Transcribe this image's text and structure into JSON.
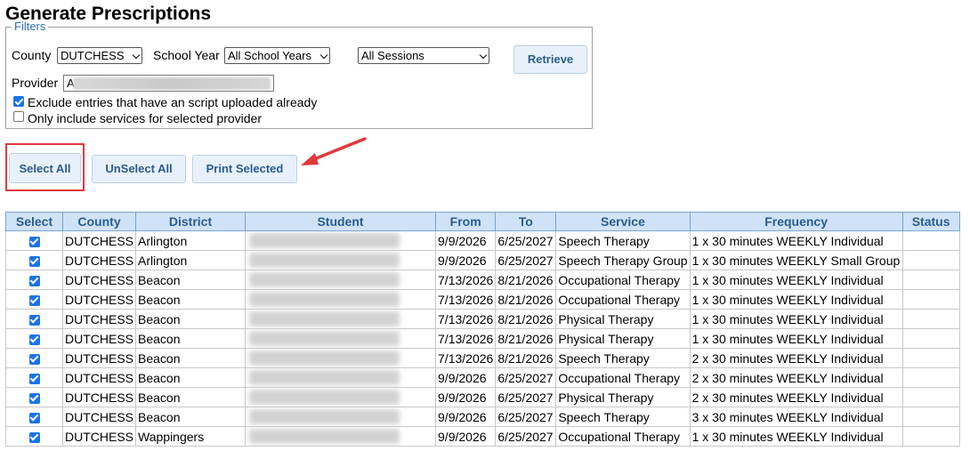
{
  "page": {
    "title": "Generate Prescriptions"
  },
  "filters": {
    "legend": "Filters",
    "county_label": "County",
    "county_value": "DUTCHESS",
    "school_year_label": "School Year",
    "school_year_value": "All School Years",
    "sessions_value": "All Sessions",
    "retrieve_label": "Retrieve",
    "provider_label": "Provider",
    "provider_value": "A",
    "exclude_label": "Exclude entries that have an script uploaded already",
    "exclude_checked": true,
    "only_include_label": "Only include services for selected provider",
    "only_include_checked": false
  },
  "actions": {
    "select_all_label": "Select All",
    "unselect_all_label": "UnSelect All",
    "print_selected_label": "Print Selected"
  },
  "annotation": {
    "highlight_color": "#e0393e",
    "arrow_color": "#e0393e"
  },
  "table": {
    "columns": [
      "Select",
      "County",
      "District",
      "Student",
      "From",
      "To",
      "Service",
      "Frequency",
      "Status"
    ],
    "rows": [
      {
        "county": "DUTCHESS",
        "district": "Arlington",
        "student": "",
        "from": "9/9/2026",
        "to": "6/25/2027",
        "service": "Speech Therapy",
        "frequency": "1 x 30 minutes WEEKLY Individual",
        "status": ""
      },
      {
        "county": "DUTCHESS",
        "district": "Arlington",
        "student": "",
        "from": "9/9/2026",
        "to": "6/25/2027",
        "service": "Speech Therapy Group",
        "frequency": "1 x 30 minutes WEEKLY Small Group",
        "status": ""
      },
      {
        "county": "DUTCHESS",
        "district": "Beacon",
        "student": "",
        "from": "7/13/2026",
        "to": "8/21/2026",
        "service": "Occupational Therapy",
        "frequency": "1 x 30 minutes WEEKLY Individual",
        "status": ""
      },
      {
        "county": "DUTCHESS",
        "district": "Beacon",
        "student": "",
        "from": "7/13/2026",
        "to": "8/21/2026",
        "service": "Occupational Therapy",
        "frequency": "1 x 30 minutes WEEKLY Individual",
        "status": ""
      },
      {
        "county": "DUTCHESS",
        "district": "Beacon",
        "student": "",
        "from": "7/13/2026",
        "to": "8/21/2026",
        "service": "Physical Therapy",
        "frequency": "1 x 30 minutes WEEKLY Individual",
        "status": ""
      },
      {
        "county": "DUTCHESS",
        "district": "Beacon",
        "student": "",
        "from": "7/13/2026",
        "to": "8/21/2026",
        "service": "Physical Therapy",
        "frequency": "1 x 30 minutes WEEKLY Individual",
        "status": ""
      },
      {
        "county": "DUTCHESS",
        "district": "Beacon",
        "student": "",
        "from": "7/13/2026",
        "to": "8/21/2026",
        "service": "Speech Therapy",
        "frequency": "2 x 30 minutes WEEKLY Individual",
        "status": ""
      },
      {
        "county": "DUTCHESS",
        "district": "Beacon",
        "student": "",
        "from": "9/9/2026",
        "to": "6/25/2027",
        "service": "Occupational Therapy",
        "frequency": "2 x 30 minutes WEEKLY Individual",
        "status": ""
      },
      {
        "county": "DUTCHESS",
        "district": "Beacon",
        "student": "",
        "from": "9/9/2026",
        "to": "6/25/2027",
        "service": "Physical Therapy",
        "frequency": "2 x 30 minutes WEEKLY Individual",
        "status": ""
      },
      {
        "county": "DUTCHESS",
        "district": "Beacon",
        "student": "",
        "from": "9/9/2026",
        "to": "6/25/2027",
        "service": "Speech Therapy",
        "frequency": "3 x 30 minutes WEEKLY Individual",
        "status": ""
      },
      {
        "county": "DUTCHESS",
        "district": "Wappingers",
        "student": "",
        "from": "9/9/2026",
        "to": "6/25/2027",
        "service": "Occupational Therapy",
        "frequency": "1 x 30 minutes WEEKLY Individual",
        "status": ""
      }
    ]
  }
}
